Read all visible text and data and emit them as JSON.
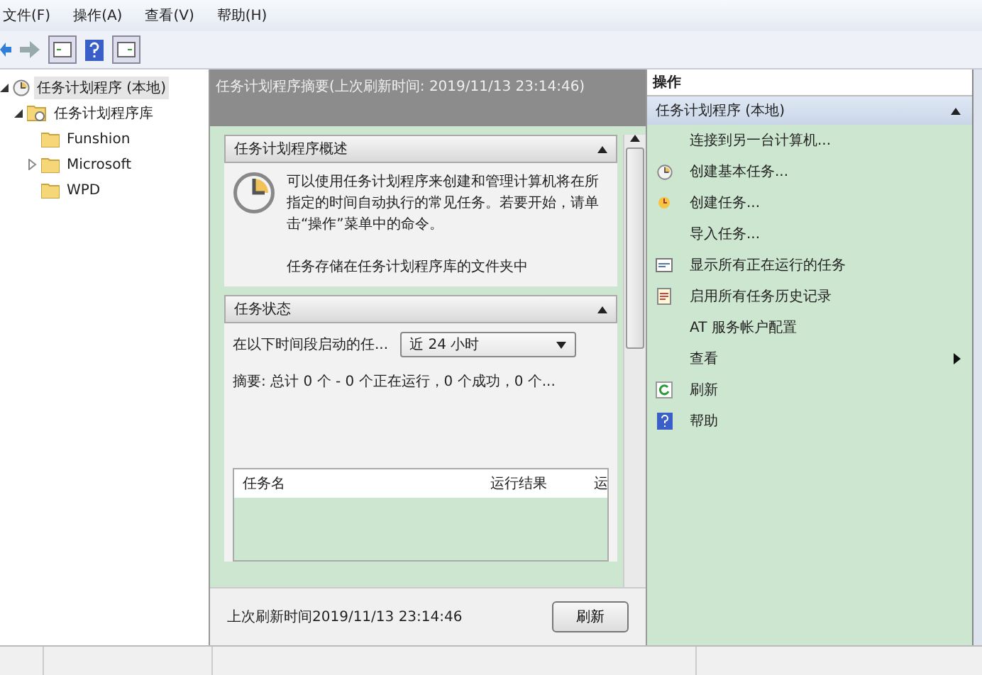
{
  "menu": [
    "文件(F)",
    "操作(A)",
    "查看(V)",
    "帮助(H)"
  ],
  "tree": [
    {
      "label": "任务计划程序 (本地)",
      "kind": "computer",
      "selected": true,
      "expanded": true,
      "children": [
        {
          "label": "任务计划程序库",
          "kind": "library",
          "selected": false,
          "expanded": true,
          "children": [
            {
              "label": "Funshion",
              "kind": "folder",
              "selected": false
            },
            {
              "label": "Microsoft",
              "kind": "folder",
              "selected": false,
              "expanded": false
            },
            {
              "label": "WPD",
              "kind": "folder",
              "selected": false
            }
          ]
        }
      ]
    }
  ],
  "summary": {
    "title": "任务计划程序摘要(上次刷新时间: 2019/11/13 23:14:46)",
    "overview": {
      "title": "任务计划程序概述",
      "text": "可以使用任务计划程序来创建和管理计算机将在所指定的时间自动执行的常见任务。若要开始，请单击“操作”菜单中的命令。",
      "text2": "任务存储在任务计划程序库的文件夹中"
    },
    "status": {
      "title": "任务状态",
      "filter_label": "在以下时间段启动的任...",
      "filter_value": "近 24 小时",
      "summary": "摘要: 总计 0 个 - 0 个正在运行，0 个成功，0 个...",
      "columns": [
        "任务名",
        "运行结果",
        "运"
      ]
    },
    "last_refresh": "上次刷新时间2019/11/13 23:14:46",
    "refresh_button": "刷新"
  },
  "actions": {
    "title": "操作",
    "group": "任务计划程序 (本地)",
    "items": [
      {
        "label": "连接到另一台计算机...",
        "kind": "plain"
      },
      {
        "label": "创建基本任务...",
        "kind": "wizard"
      },
      {
        "label": "创建任务...",
        "kind": "task"
      },
      {
        "label": "导入任务...",
        "kind": "plain"
      },
      {
        "label": "显示所有正在运行的任务",
        "kind": "running"
      },
      {
        "label": "启用所有任务历史记录",
        "kind": "history"
      },
      {
        "label": "AT 服务帐户配置",
        "kind": "plain"
      },
      {
        "label": "查看",
        "kind": "submenu"
      },
      {
        "label": "刷新",
        "kind": "refresh"
      },
      {
        "label": "帮助",
        "kind": "help"
      }
    ]
  }
}
